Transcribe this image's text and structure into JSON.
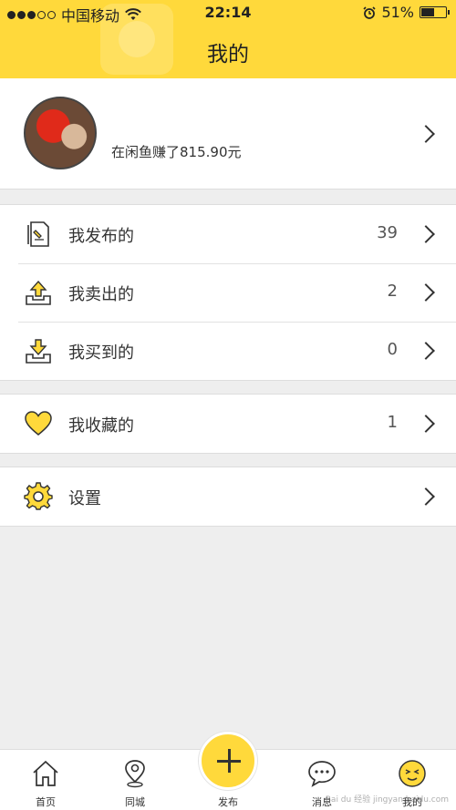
{
  "status_bar": {
    "carrier": "中国移动",
    "time": "22:14",
    "battery": "51%",
    "battery_level": 0.51
  },
  "header": {
    "title": "我的"
  },
  "profile": {
    "earnings_text": "在闲鱼赚了815.90元"
  },
  "menu_groups": [
    {
      "items": [
        {
          "label": "我发布的",
          "count": "39",
          "icon": "document-icon"
        },
        {
          "label": "我卖出的",
          "count": "2",
          "icon": "upload-tray-icon"
        },
        {
          "label": "我买到的",
          "count": "0",
          "icon": "download-tray-icon"
        }
      ]
    },
    {
      "items": [
        {
          "label": "我收藏的",
          "count": "1",
          "icon": "heart-icon"
        }
      ]
    },
    {
      "items": [
        {
          "label": "设置",
          "count": "",
          "icon": "gear-icon"
        }
      ]
    }
  ],
  "tabbar": {
    "tabs": [
      {
        "label": "首页",
        "icon": "home-icon"
      },
      {
        "label": "同城",
        "icon": "location-pin-icon"
      },
      {
        "label": "发布",
        "icon": "plus-icon"
      },
      {
        "label": "消息",
        "icon": "chat-bubble-icon"
      },
      {
        "label": "我的",
        "icon": "face-icon"
      }
    ]
  },
  "watermark": "Bai du 经验 jingyan.baidu.com",
  "colors": {
    "accent": "#ffd93b",
    "background": "#eeeeee"
  }
}
